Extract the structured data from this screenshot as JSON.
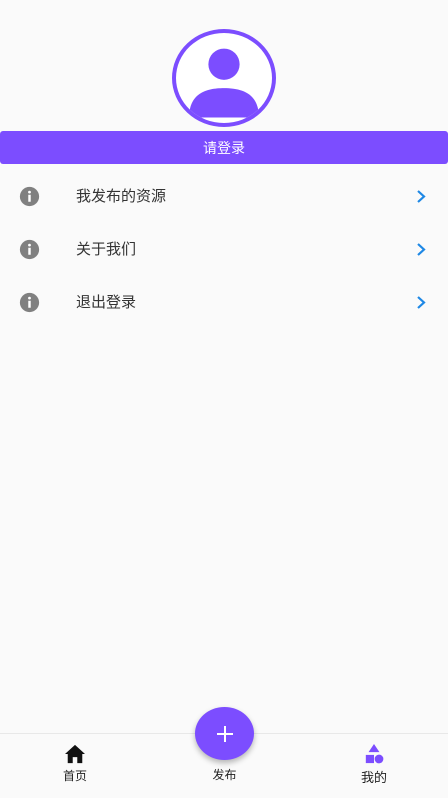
{
  "colors": {
    "accent": "#7c4dff",
    "icon_gray": "#808080",
    "chevron": "#1e88e5"
  },
  "login": {
    "label": "请登录"
  },
  "menu": {
    "items": [
      {
        "label": "我发布的资源",
        "icon": "info-icon"
      },
      {
        "label": "关于我们",
        "icon": "info-icon"
      },
      {
        "label": "退出登录",
        "icon": "info-icon"
      }
    ]
  },
  "nav": {
    "home": {
      "label": "首页",
      "icon": "home-icon"
    },
    "publish": {
      "label": "发布",
      "icon": "plus-icon"
    },
    "mine": {
      "label": "我的",
      "icon": "category-icon"
    }
  }
}
